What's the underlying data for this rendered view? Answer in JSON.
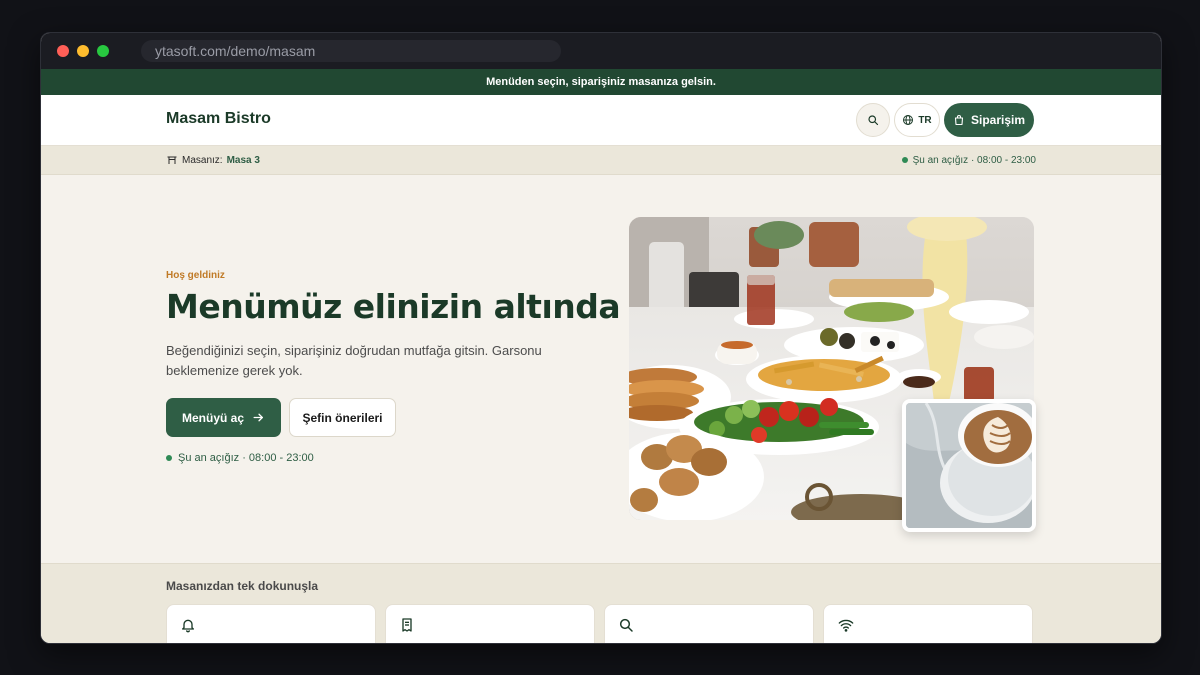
{
  "browser": {
    "url": "ytasoft.com/demo/masam"
  },
  "announcement": "Menüden seçin, siparişiniz masanıza gelsin.",
  "navbar": {
    "brand": "Masam Bistro",
    "search_icon": "search-icon",
    "language": "TR",
    "order_label": "Siparişim"
  },
  "table_bar": {
    "label": "Masanız:",
    "table": "Masa 3",
    "status": "Şu an açığız · 08:00 - 23:00"
  },
  "hero": {
    "eyebrow": "Hoş geldiniz",
    "title": "Menümüz elinizin altında",
    "subtitle": "Beğendiğinizi seçin, siparişiniz doğrudan mutfağa gitsin. Garsonu beklemenize gerek yok.",
    "primary_cta": "Menüyü aç",
    "secondary_cta": "Şefin önerileri",
    "status": "Şu an açığız · 08:00 - 23:00"
  },
  "quick_actions": {
    "title": "Masanızdan tek dokunuşla",
    "cards": [
      {
        "icon": "bell-icon"
      },
      {
        "icon": "receipt-icon"
      },
      {
        "icon": "search-icon"
      },
      {
        "icon": "wifi-icon"
      }
    ]
  },
  "colors": {
    "brand_green": "#2f5e45",
    "dark_green": "#214832",
    "accent_orange": "#c07a26",
    "background": "#f5f2ec"
  }
}
